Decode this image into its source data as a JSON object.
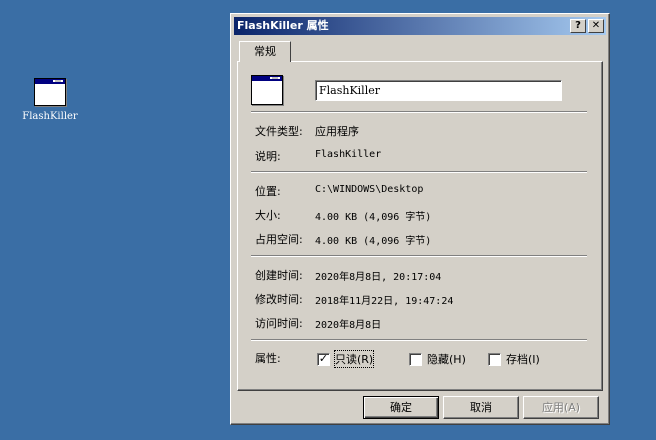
{
  "desktop": {
    "icon_label": "FlashKiller"
  },
  "dialog": {
    "title": "FlashKiller 属性",
    "help_glyph": "?",
    "close_glyph": "✕",
    "tab_label": "常规",
    "file_name": "FlashKiller",
    "fields": {
      "type_label": "文件类型:",
      "type_value": "应用程序",
      "desc_label": "说明:",
      "desc_value": "FlashKiller",
      "location_label": "位置:",
      "location_value": "C:\\WINDOWS\\Desktop",
      "size_label": "大小:",
      "size_value": "4.00 KB (4,096 字节)",
      "disk_label": "占用空间:",
      "disk_value": "4.00 KB (4,096 字节)",
      "created_label": "创建时间:",
      "created_value": "2020年8月8日, 20:17:04",
      "modified_label": "修改时间:",
      "modified_value": "2018年11月22日, 19:47:24",
      "accessed_label": "访问时间:",
      "accessed_value": "2020年8月8日"
    },
    "attributes": {
      "label": "属性:",
      "readonly": {
        "label": "只读(R)",
        "checked": true,
        "check_glyph": "✓"
      },
      "hidden": {
        "label": "隐藏(H)",
        "checked": false
      },
      "archive": {
        "label": "存档(I)",
        "checked": false
      }
    },
    "buttons": {
      "ok": "确定",
      "cancel": "取消",
      "apply": "应用(A)"
    }
  }
}
